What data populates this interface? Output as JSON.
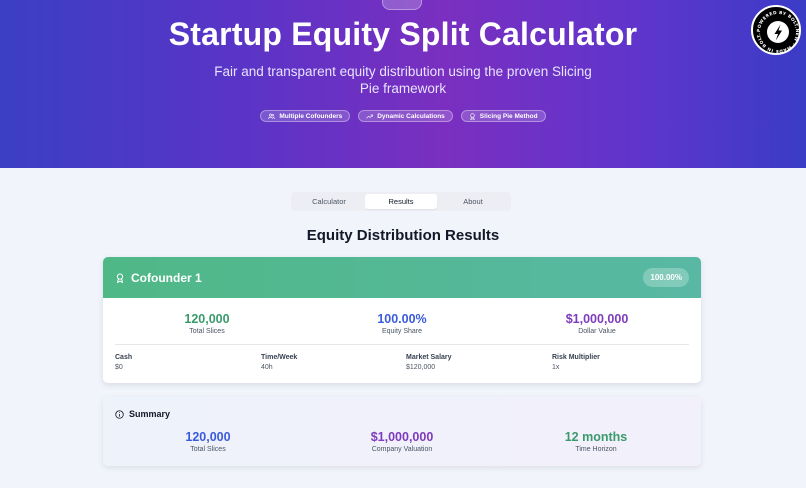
{
  "hero": {
    "title": "Startup Equity Split Calculator",
    "subtitle": "Fair and transparent equity distribution using the proven Slicing Pie framework",
    "pills": [
      {
        "label": "Multiple Cofounders",
        "icon": "users-icon"
      },
      {
        "label": "Dynamic Calculations",
        "icon": "trending-up-icon"
      },
      {
        "label": "Slicing Pie Method",
        "icon": "award-icon"
      }
    ],
    "badge_text": "POWERED BY BOLT.NEW · MADE IN BOLT.NEW ·"
  },
  "tabs": [
    {
      "label": "Calculator",
      "active": false
    },
    {
      "label": "Results",
      "active": true
    },
    {
      "label": "About",
      "active": false
    }
  ],
  "results_title": "Equity Distribution Results",
  "cofounder": {
    "name": "Cofounder 1",
    "percentage": "100.00%",
    "stats": [
      {
        "value": "120,000",
        "label": "Total Slices",
        "color": "#3a9a6b"
      },
      {
        "value": "100.00%",
        "label": "Equity Share",
        "color": "#3b5bdb"
      },
      {
        "value": "$1,000,000",
        "label": "Dollar Value",
        "color": "#7e3bbd"
      }
    ],
    "details": [
      {
        "label": "Cash",
        "value": "$0"
      },
      {
        "label": "Time/Week",
        "value": "40h"
      },
      {
        "label": "Market Salary",
        "value": "$120,000"
      },
      {
        "label": "Risk Multiplier",
        "value": "1x"
      }
    ]
  },
  "summary": {
    "title": "Summary",
    "stats": [
      {
        "value": "120,000",
        "label": "Total Slices",
        "color": "#3b5bdb"
      },
      {
        "value": "$1,000,000",
        "label": "Company Valuation",
        "color": "#7e3bbd"
      },
      {
        "value": "12 months",
        "label": "Time Horizon",
        "color": "#3a9a6b"
      }
    ]
  },
  "colors": {
    "hero_gradient_start": "#3b3fc4",
    "hero_gradient_mid": "#7a2fc0",
    "card_header_green": "#4fb886"
  }
}
